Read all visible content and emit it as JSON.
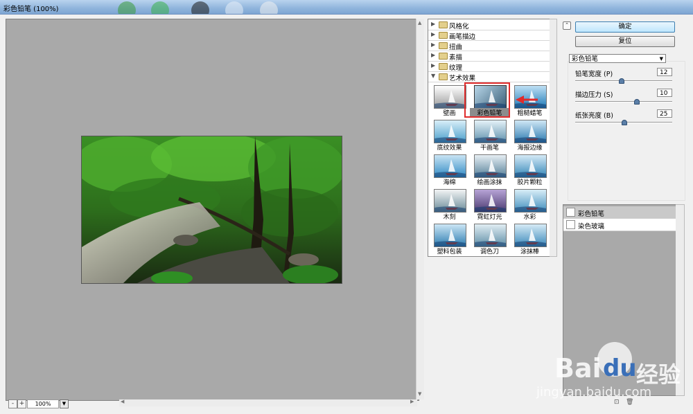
{
  "window": {
    "title": "彩色铅笔 (100%)"
  },
  "zoom": {
    "minus": "-",
    "plus": "+",
    "value": "100%",
    "dropdown": "▼"
  },
  "scroll": {
    "up": "▲",
    "down": "▼",
    "left": "◀",
    "right": "▶"
  },
  "gallery": {
    "folders": [
      {
        "label": "风格化",
        "expanded": false
      },
      {
        "label": "画笔描边",
        "expanded": false
      },
      {
        "label": "扭曲",
        "expanded": false
      },
      {
        "label": "素描",
        "expanded": false
      },
      {
        "label": "纹理",
        "expanded": false
      },
      {
        "label": "艺术效果",
        "expanded": true
      }
    ],
    "filters": [
      {
        "label": "壁画"
      },
      {
        "label": "彩色铅笔",
        "selected": true
      },
      {
        "label": "粗糙蜡笔"
      },
      {
        "label": "底纹效果"
      },
      {
        "label": "干画笔"
      },
      {
        "label": "海报边缘"
      },
      {
        "label": "海绵"
      },
      {
        "label": "绘画涂抹"
      },
      {
        "label": "胶片颗粒"
      },
      {
        "label": "木刻"
      },
      {
        "label": "霓虹灯光"
      },
      {
        "label": "水彩"
      },
      {
        "label": "塑料包装"
      },
      {
        "label": "调色刀"
      },
      {
        "label": "涂抹棒"
      }
    ],
    "highlight_color": "#e02b2b"
  },
  "buttons": {
    "collapse": "⌃",
    "ok": "确定",
    "reset": "复位"
  },
  "settings": {
    "filter_select": "彩色铅笔",
    "params": [
      {
        "label": "铅笔宽度 (P)",
        "value": "12",
        "fraction": 0.47
      },
      {
        "label": "描边压力 (S)",
        "value": "10",
        "fraction": 0.625
      },
      {
        "label": "纸张亮度 (B)",
        "value": "25",
        "fraction": 0.5
      }
    ]
  },
  "layers": [
    {
      "name": "彩色铅笔",
      "active": true
    },
    {
      "name": "染色玻璃",
      "active": false
    }
  ],
  "layer_actions": {
    "new": "⊡",
    "delete": "🗑"
  },
  "watermark": {
    "brand_a": "Bai",
    "brand_b": "du",
    "brand_cn": "经验",
    "url": "jingyan.baidu.com"
  }
}
